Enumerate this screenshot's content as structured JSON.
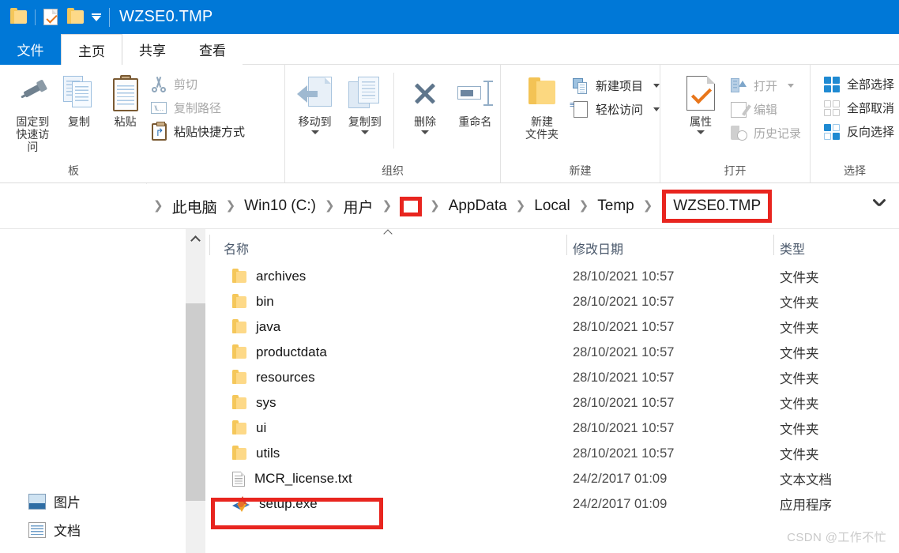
{
  "window": {
    "title": "WZSE0.TMP",
    "quick_access_icons": [
      "folder-icon",
      "properties-check-icon",
      "new-folder-icon"
    ],
    "accent_color": "#0078d7",
    "highlight_color": "#e8251f"
  },
  "ribbon": {
    "tabs": [
      {
        "label": "文件",
        "name": "tab-file",
        "active": false
      },
      {
        "label": "主页",
        "name": "tab-home",
        "active": true
      },
      {
        "label": "共享",
        "name": "tab-share",
        "active": false
      },
      {
        "label": "查看",
        "name": "tab-view",
        "active": false
      }
    ],
    "groups": [
      {
        "label": "板",
        "full_label": "剪贴板",
        "big_buttons": [
          {
            "label": "固定到快速访问",
            "icon": "pin-icon"
          },
          {
            "label": "复制",
            "icon": "copy-icon"
          },
          {
            "label": "粘贴",
            "icon": "paste-icon"
          }
        ],
        "small_buttons": [
          {
            "label": "剪切",
            "icon": "scissors-icon",
            "dim": true
          },
          {
            "label": "复制路径",
            "icon": "copy-path-icon",
            "dim": true
          },
          {
            "label": "粘贴快捷方式",
            "icon": "paste-shortcut-icon",
            "dim": false
          }
        ]
      },
      {
        "label": "组织",
        "big_buttons": [
          {
            "label": "移动到",
            "icon": "move-to-icon",
            "has_caret": true
          },
          {
            "label": "复制到",
            "icon": "copy-to-icon",
            "has_caret": true
          },
          {
            "label": "删除",
            "icon": "delete-icon",
            "has_caret": true
          },
          {
            "label": "重命名",
            "icon": "rename-icon",
            "has_caret": false
          }
        ]
      },
      {
        "label": "新建",
        "big_buttons": [
          {
            "label": "新建\n文件夹",
            "line1": "新建",
            "line2": "文件夹",
            "icon": "new-folder-icon"
          }
        ],
        "small_buttons": [
          {
            "label": "新建项目",
            "icon": "new-item-icon",
            "has_caret": true
          },
          {
            "label": "轻松访问",
            "icon": "easy-access-icon",
            "has_caret": true
          }
        ]
      },
      {
        "label": "打开",
        "big_buttons": [
          {
            "label": "属性",
            "icon": "properties-icon",
            "has_caret": true
          }
        ],
        "small_buttons": [
          {
            "label": "打开",
            "icon": "open-icon",
            "has_caret": true,
            "dim": true
          },
          {
            "label": "编辑",
            "icon": "edit-icon",
            "dim": true
          },
          {
            "label": "历史记录",
            "icon": "history-icon",
            "dim": true
          }
        ]
      },
      {
        "label": "选择",
        "small_buttons": [
          {
            "label": "全部选择",
            "icon": "select-all-icon"
          },
          {
            "label": "全部取消",
            "icon": "select-none-icon"
          },
          {
            "label": "反向选择",
            "icon": "invert-selection-icon"
          }
        ]
      }
    ]
  },
  "address": {
    "crumbs": [
      {
        "label": "此电脑",
        "name": "breadcrumb-this-pc",
        "style": "normal"
      },
      {
        "label": "Win10 (C:)",
        "name": "breadcrumb-win10-c",
        "style": "normal"
      },
      {
        "label": "用户",
        "name": "breadcrumb-users",
        "style": "normal"
      },
      {
        "label": "",
        "name": "breadcrumb-username-redacted",
        "style": "redacted"
      },
      {
        "label": "AppData",
        "name": "breadcrumb-appdata",
        "style": "normal"
      },
      {
        "label": "Local",
        "name": "breadcrumb-local",
        "style": "normal"
      },
      {
        "label": "Temp",
        "name": "breadcrumb-temp",
        "style": "normal"
      },
      {
        "label": "WZSE0.TMP",
        "name": "breadcrumb-wzse0-tmp",
        "style": "boxed"
      }
    ]
  },
  "nav_pane": {
    "items": [
      {
        "label": "图片",
        "icon": "pictures-icon"
      },
      {
        "label": "文档",
        "icon": "documents-icon"
      }
    ]
  },
  "file_list": {
    "columns": [
      "名称",
      "修改日期",
      "类型"
    ],
    "sort": {
      "column": "名称",
      "direction": "ascending"
    },
    "rows": [
      {
        "name": "archives",
        "icon": "folder-icon",
        "date": "28/10/2021 10:57",
        "type": "文件夹"
      },
      {
        "name": "bin",
        "icon": "folder-icon",
        "date": "28/10/2021 10:57",
        "type": "文件夹"
      },
      {
        "name": "java",
        "icon": "folder-icon",
        "date": "28/10/2021 10:57",
        "type": "文件夹"
      },
      {
        "name": "productdata",
        "icon": "folder-icon",
        "date": "28/10/2021 10:57",
        "type": "文件夹"
      },
      {
        "name": "resources",
        "icon": "folder-icon",
        "date": "28/10/2021 10:57",
        "type": "文件夹"
      },
      {
        "name": "sys",
        "icon": "folder-icon",
        "date": "28/10/2021 10:57",
        "type": "文件夹"
      },
      {
        "name": "ui",
        "icon": "folder-icon",
        "date": "28/10/2021 10:57",
        "type": "文件夹"
      },
      {
        "name": "utils",
        "icon": "folder-icon",
        "date": "28/10/2021 10:57",
        "type": "文件夹"
      },
      {
        "name": "MCR_license.txt",
        "icon": "text-file-icon",
        "date": "24/2/2017 01:09",
        "type": "文本文档"
      },
      {
        "name": "setup.exe",
        "icon": "matlab-icon",
        "date": "24/2/2017 01:09",
        "type": "应用程序",
        "highlighted": true
      }
    ]
  },
  "watermark": {
    "text": "CSDN @工作不忙"
  }
}
